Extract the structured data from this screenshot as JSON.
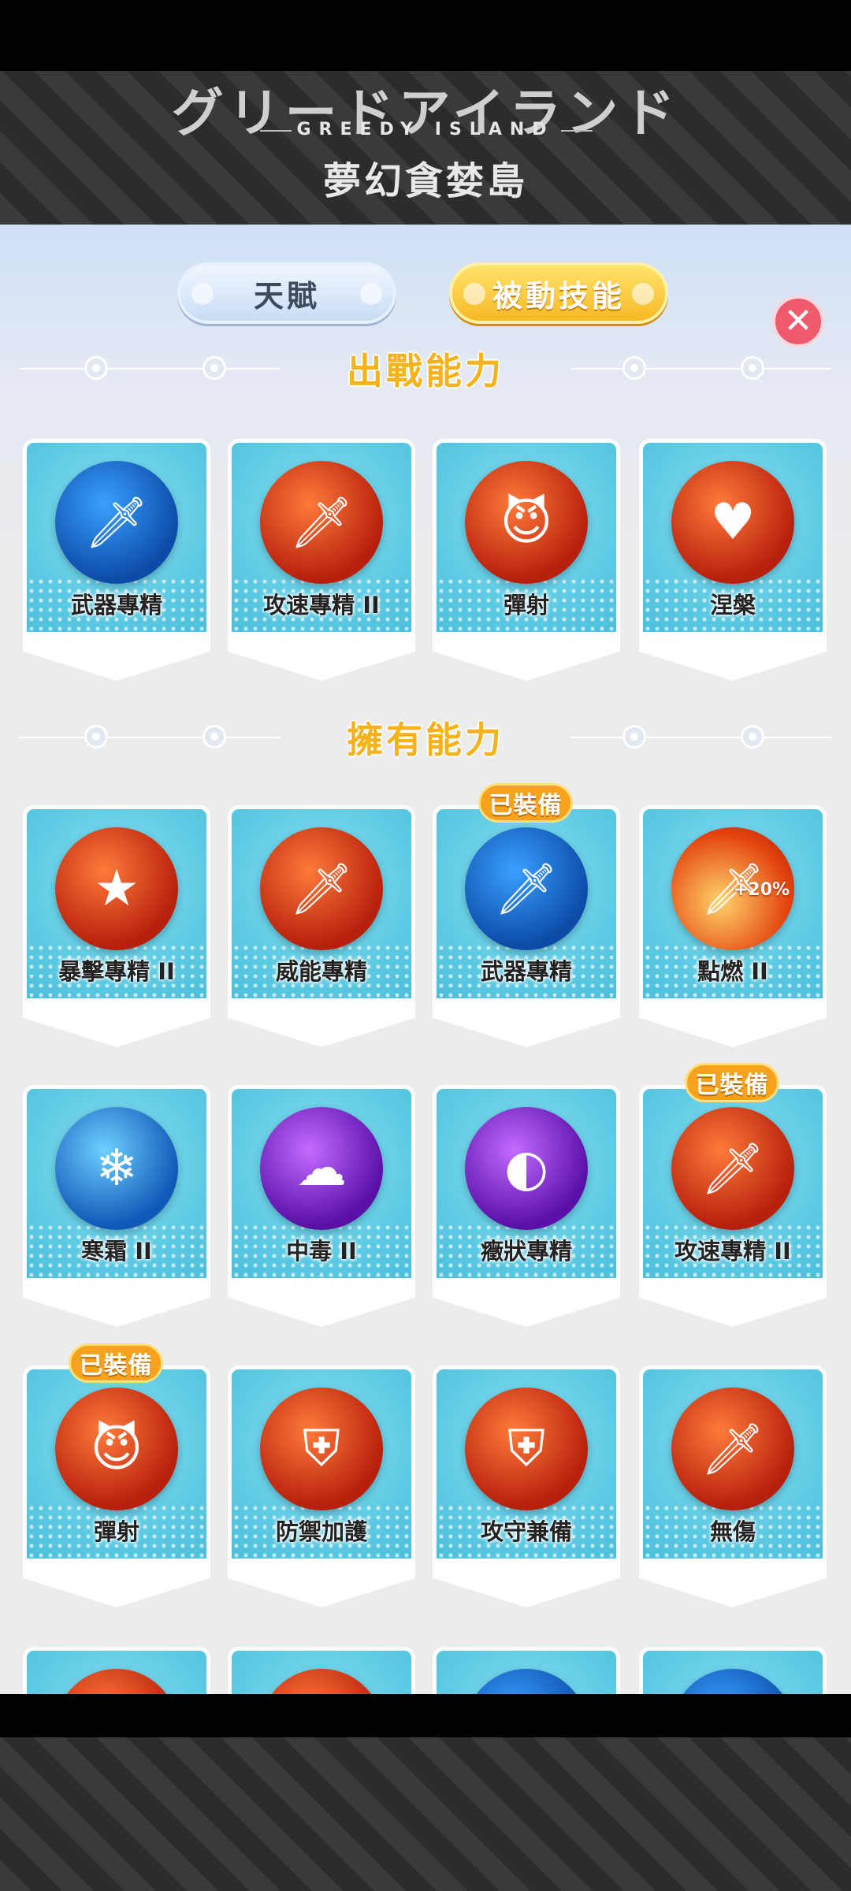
{
  "banner": {
    "title_jp": "グリードアイランド",
    "title_en": "GREEDY ISLAND",
    "title_cn": "夢幻貪婪島"
  },
  "tabs": [
    {
      "label": "天賦",
      "selected": false
    },
    {
      "label": "被動技能",
      "selected": true
    }
  ],
  "close_icon": "close-icon",
  "sections": {
    "battle_title": "出戰能力",
    "owned_title": "擁有能力"
  },
  "battle_skills": [
    {
      "label": "武器專精",
      "icon": "sword-upgrade-icon",
      "color": "#0c4ca8"
    },
    {
      "label": "攻速專精 II",
      "icon": "sword-speed-icon",
      "color": "#b7200c"
    },
    {
      "label": "彈射",
      "icon": "bounce-icon",
      "color": "#b7200c"
    },
    {
      "label": "涅槃",
      "icon": "heart-revive-icon",
      "color": "#b7200c"
    }
  ],
  "owned_skills": [
    {
      "label": "暴擊專精 II",
      "icon": "crit-star-icon",
      "equipped": ""
    },
    {
      "label": "威能專精",
      "icon": "power-sword-icon",
      "equipped": ""
    },
    {
      "label": "武器專精",
      "icon": "sword-upgrade-icon",
      "equipped": "已裝備"
    },
    {
      "label": "點燃 II",
      "icon": "ignite-icon",
      "equipped": "",
      "bonus": "+20%"
    },
    {
      "label": "寒霜 II",
      "icon": "frost-icon",
      "equipped": ""
    },
    {
      "label": "中毒 II",
      "icon": "poison-icon",
      "equipped": ""
    },
    {
      "label": "癥狀專精",
      "icon": "status-orb-icon",
      "equipped": ""
    },
    {
      "label": "攻速專精 II",
      "icon": "sword-speed-icon",
      "equipped": "已裝備"
    },
    {
      "label": "彈射",
      "icon": "bounce-icon",
      "equipped": "已裝備"
    },
    {
      "label": "防禦加護",
      "icon": "shield-icon",
      "equipped": ""
    },
    {
      "label": "攻守兼備",
      "icon": "attack-defense-icon",
      "equipped": ""
    },
    {
      "label": "無傷",
      "icon": "invincible-icon",
      "equipped": ""
    }
  ]
}
